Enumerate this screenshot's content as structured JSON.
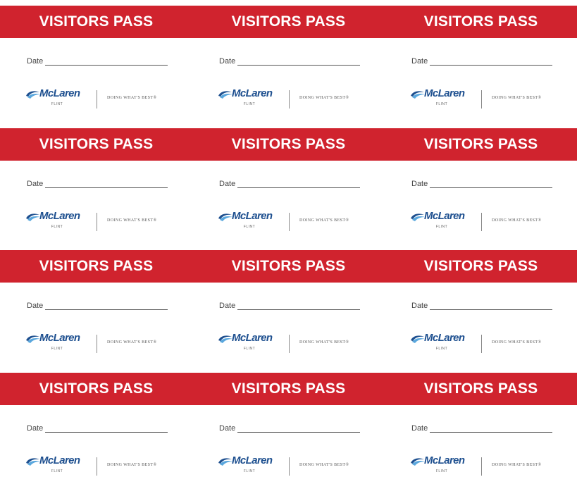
{
  "pass": {
    "title": "VISITORS PASS",
    "date_label": "Date",
    "brand_name": "McLaren",
    "brand_location": "FLINT",
    "tagline": "DOING WHAT'S BEST®"
  },
  "rows": 4,
  "columns": 3,
  "colors": {
    "band": "#d0232e",
    "brand_blue": "#1d4f8f",
    "swoosh_light": "#5aa7dd"
  },
  "icons": {
    "logo_mark": "mclaren-swoosh-icon"
  }
}
